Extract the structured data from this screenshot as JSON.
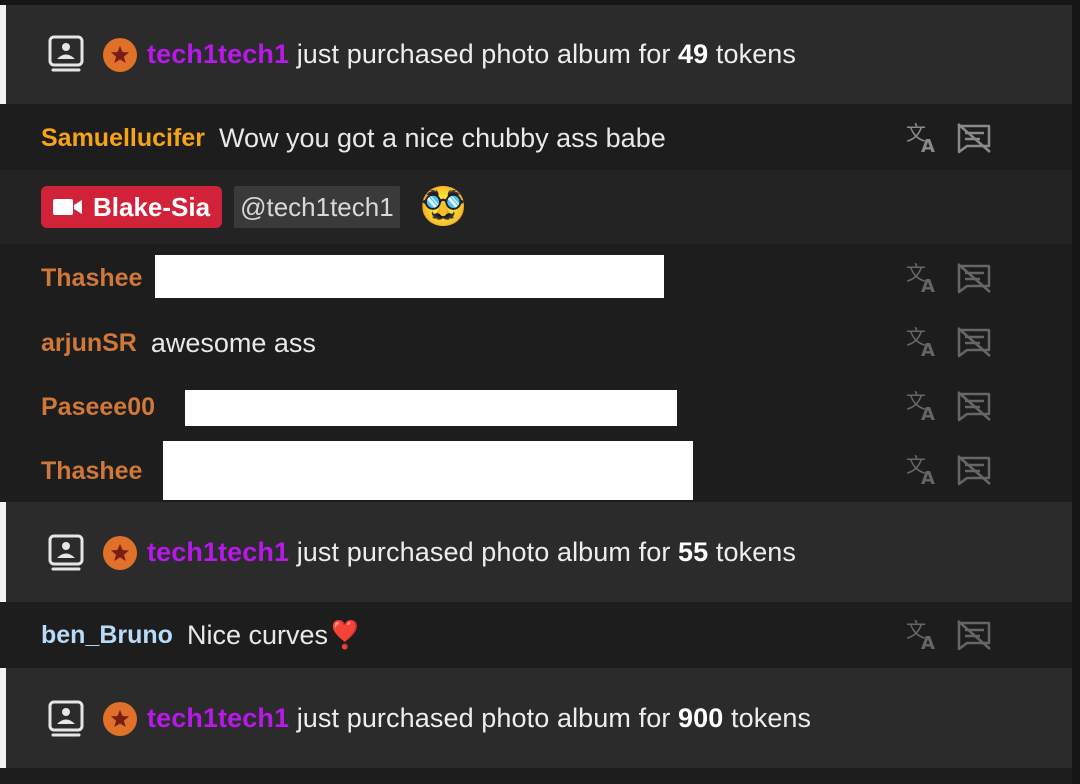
{
  "colors": {
    "buyer": "#b619e8",
    "user_gold": "#f6a315",
    "user_orange": "#d0773a",
    "user_blue": "#b9dbf7",
    "tip_red": "#d1223a",
    "star_orange": "#e0712b"
  },
  "events": [
    {
      "icon": "photo-album-icon",
      "buyer": "tech1tech1",
      "pre": "just purchased photo album for",
      "amount": "49",
      "unit": "tokens"
    },
    {
      "icon": "photo-album-icon",
      "buyer": "tech1tech1",
      "pre": "just purchased photo album for",
      "amount": "55",
      "unit": "tokens"
    },
    {
      "icon": "photo-album-icon",
      "buyer": "tech1tech1",
      "pre": "just purchased photo album for",
      "amount": "900",
      "unit": "tokens"
    }
  ],
  "messages": [
    {
      "user": "Samuellucifer",
      "text": "Wow you got a nice chubby ass babe"
    },
    {
      "user": "Thashee",
      "text": ""
    },
    {
      "user": "arjunSR",
      "text": "awesome ass"
    },
    {
      "user": "Paseee00",
      "text": ""
    },
    {
      "user": "Thashee",
      "text": ""
    },
    {
      "user": "ben_Bruno",
      "text": "Nice curves❣️"
    }
  ],
  "tip": {
    "icon": "video-camera-icon",
    "user": "Blake-Sia",
    "mention": "@tech1tech1",
    "emoji": "🥸"
  },
  "actions": {
    "translate_icon": "translate-icon",
    "hide_icon": "hide-message-icon"
  }
}
